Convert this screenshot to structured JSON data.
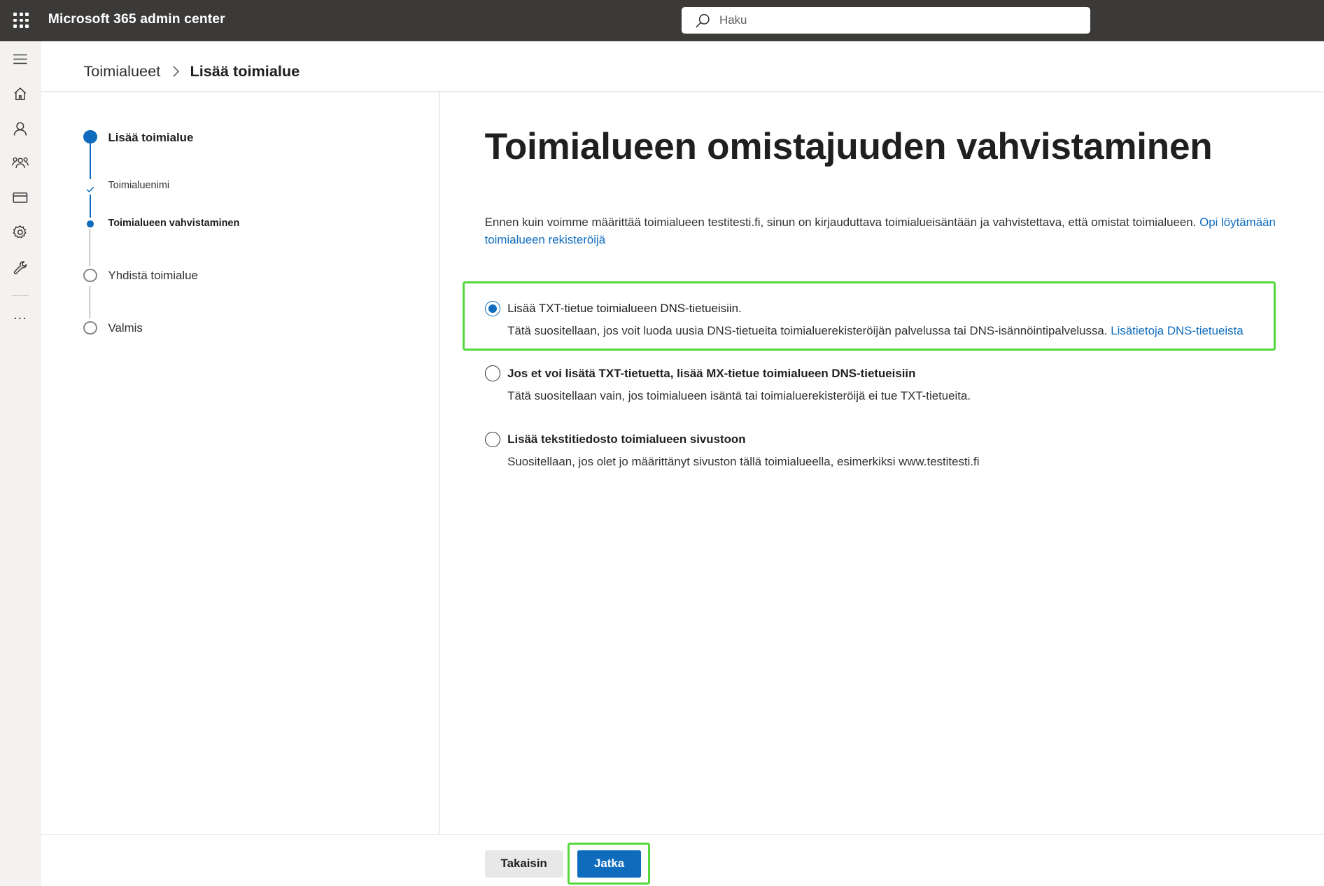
{
  "header": {
    "app_title": "Microsoft 365 admin center",
    "search_placeholder": "Haku"
  },
  "rail": {
    "icons": [
      "menu-icon",
      "home-icon",
      "user-icon",
      "groups-icon",
      "billing-icon",
      "settings-icon",
      "setup-icon",
      "more-icon"
    ],
    "more_label": "..."
  },
  "breadcrumb": {
    "parent": "Toimialueet",
    "current": "Lisää toimialue"
  },
  "stepper": {
    "steps": [
      {
        "label": "Lisää toimialue",
        "state": "current"
      },
      {
        "label": "Toimialuenimi",
        "state": "done"
      },
      {
        "label": "Toimialueen vahvistaminen",
        "state": "current-substep"
      },
      {
        "label": "Yhdistä toimialue",
        "state": "pending"
      },
      {
        "label": "Valmis",
        "state": "pending"
      }
    ]
  },
  "main": {
    "title": "Toimialueen omistajuuden vahvistaminen",
    "intro_text": "Ennen kuin voimme määrittää toimialueen testitesti.fi, sinun on kirjauduttava toimialueisäntään ja vahvistettava, että omistat toimialueen.",
    "intro_link": "Opi löytämään toimialueen rekisteröijä",
    "options": [
      {
        "title": "Lisää TXT-tietue toimialueen DNS-tietueisiin.",
        "description": "Tätä suositellaan, jos voit luoda uusia DNS-tietueita toimialuerekisteröijän palvelussa tai DNS-isännöintipalvelussa.",
        "link": "Lisätietoja DNS-tietueista",
        "selected": true
      },
      {
        "title": "Jos et voi lisätä TXT-tietuetta, lisää MX-tietue toimialueen DNS-tietueisiin",
        "description": "Tätä suositellaan vain, jos toimialueen isäntä tai toimialuerekisteröijä ei tue TXT-tietueita.",
        "selected": false
      },
      {
        "title": "Lisää tekstitiedosto toimialueen sivustoon",
        "description": "Suositellaan, jos olet jo määrittänyt sivuston tällä toimialueella, esimerkiksi www.testitesti.fi",
        "selected": false
      }
    ]
  },
  "footer": {
    "back_label": "Takaisin",
    "next_label": "Jatka"
  },
  "colors": {
    "topbar": "#3b3a39",
    "accent": "#0f6cbd",
    "highlight": "#55d93a",
    "rail": "#f3f2f1"
  }
}
